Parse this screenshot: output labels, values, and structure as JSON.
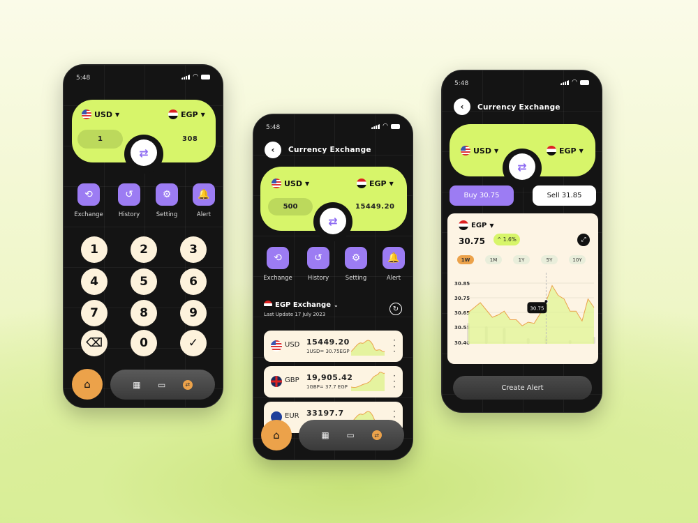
{
  "status_time": "5:48",
  "actions": [
    {
      "label": "Exchange",
      "icon": "exchange-icon"
    },
    {
      "label": "History",
      "icon": "history-icon"
    },
    {
      "label": "Setting",
      "icon": "gear-icon"
    },
    {
      "label": "Alert",
      "icon": "bell-icon"
    }
  ],
  "screen1": {
    "from": "USD",
    "to": "EGP",
    "amount": "1",
    "result": "308",
    "keys": [
      "1",
      "2",
      "3",
      "4",
      "5",
      "6",
      "7",
      "8",
      "9",
      "⌫",
      "0",
      "✓"
    ]
  },
  "screen2": {
    "title": "Currency Exchange",
    "from": "USD",
    "to": "EGP",
    "amount": "500",
    "result": "15449.20",
    "section_title": "EGP Exchange",
    "last_update": "Last Update 17 July 2023",
    "rates": [
      {
        "code": "USD",
        "amount": "15449.20",
        "rate": "1USD= 30.75EGP",
        "flag": "usd"
      },
      {
        "code": "GBP",
        "amount": "19,905.42",
        "rate": "1GBP= 37.7 EGP",
        "flag": "gbp"
      },
      {
        "code": "EUR",
        "amount": "33197.7",
        "rate": "",
        "flag": "eur"
      }
    ]
  },
  "screen3": {
    "title": "Currency Exchange",
    "from": "USD",
    "to": "EGP",
    "buy": "Buy 30.75",
    "sell": "Sell 31.85",
    "chart_currency": "EGP",
    "price": "30.75",
    "change": "^ 1.6%",
    "ranges": [
      "1W",
      "1M",
      "1Y",
      "5Y",
      "10Y"
    ],
    "active_range": "1W",
    "tooltip": "30.75",
    "create_alert": "Create Alert"
  },
  "colors": {
    "accent_green": "#d7f56a",
    "purple": "#9c7cf3",
    "orange": "#eca24a",
    "cream": "#fdf4e2"
  },
  "chart_data": {
    "type": "line",
    "yticks": [
      "30.85",
      "30.75",
      "30.65",
      "30.55",
      "30.40"
    ],
    "ylim": [
      30.5,
      30.9
    ],
    "values": [
      30.66,
      30.7,
      30.74,
      30.68,
      30.62,
      30.64,
      30.67,
      30.6,
      30.6,
      30.55,
      30.58,
      30.57,
      30.65,
      30.75,
      30.88,
      30.8,
      30.77,
      30.67,
      30.67,
      30.59,
      30.77,
      30.7
    ],
    "highlight": "30.75"
  }
}
